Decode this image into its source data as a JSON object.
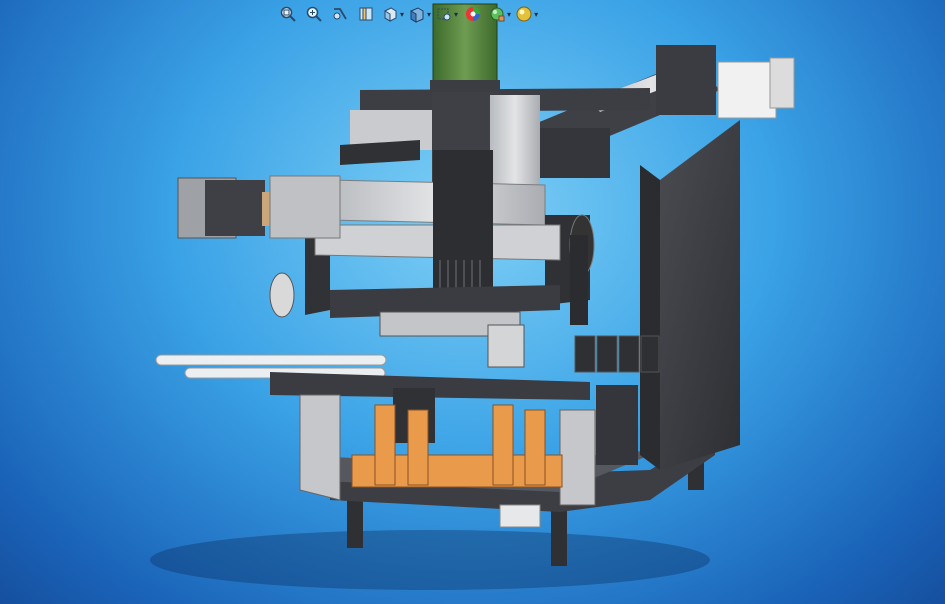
{
  "viewport": {
    "background_top": "#7fd0f6",
    "background_bottom": "#164f9e"
  },
  "heads_up_toolbar": {
    "items": [
      {
        "icon": "zoom-to-fit-icon"
      },
      {
        "icon": "zoom-to-area-icon"
      },
      {
        "icon": "previous-view-icon"
      },
      {
        "icon": "section-view-icon"
      },
      {
        "icon": "view-orientation-icon",
        "dropdown": true
      },
      {
        "icon": "display-style-icon",
        "dropdown": true
      },
      {
        "icon": "hide-show-items-icon",
        "dropdown": true
      },
      {
        "icon": "edit-appearance-icon",
        "dropdown": true
      },
      {
        "icon": "apply-scene-icon",
        "dropdown": true
      },
      {
        "icon": "view-settings-icon",
        "dropdown": true
      }
    ]
  },
  "model": {
    "colors": {
      "frame_dark": "#3b3d42",
      "aluminum": "#c7c9cc",
      "motor_green": "#4f7a3a",
      "fixture_orange": "#e99a4b",
      "white_part": "#f2f2f2"
    }
  }
}
